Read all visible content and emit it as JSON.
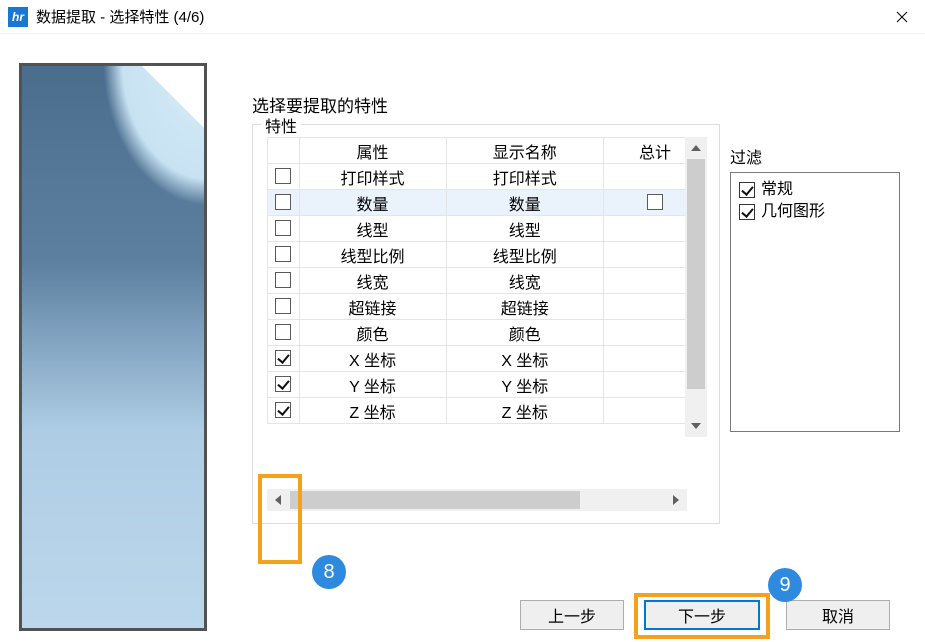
{
  "window": {
    "title": "数据提取 - 选择特性 (4/6)",
    "app_icon_text": "hr"
  },
  "main": {
    "heading": "选择要提取的特性",
    "props_group_label": "特性",
    "table": {
      "headers": {
        "attr": "属性",
        "display": "显示名称",
        "total": "总计"
      },
      "rows": [
        {
          "checked": false,
          "attr": "打印样式",
          "display": "打印样式",
          "total_chk": null,
          "selected": false
        },
        {
          "checked": false,
          "attr": "数量",
          "display": "数量",
          "total_chk": false,
          "selected": true
        },
        {
          "checked": false,
          "attr": "线型",
          "display": "线型",
          "total_chk": null,
          "selected": false
        },
        {
          "checked": false,
          "attr": "线型比例",
          "display": "线型比例",
          "total_chk": null,
          "selected": false
        },
        {
          "checked": false,
          "attr": "线宽",
          "display": "线宽",
          "total_chk": null,
          "selected": false
        },
        {
          "checked": false,
          "attr": "超链接",
          "display": "超链接",
          "total_chk": null,
          "selected": false
        },
        {
          "checked": false,
          "attr": "颜色",
          "display": "颜色",
          "total_chk": null,
          "selected": false
        },
        {
          "checked": true,
          "attr": "X 坐标",
          "display": "X 坐标",
          "total_chk": null,
          "selected": false
        },
        {
          "checked": true,
          "attr": "Y 坐标",
          "display": "Y 坐标",
          "total_chk": null,
          "selected": false
        },
        {
          "checked": true,
          "attr": "Z 坐标",
          "display": "Z 坐标",
          "total_chk": null,
          "selected": false
        }
      ]
    },
    "filter": {
      "label": "过滤",
      "items": [
        {
          "checked": true,
          "label": "常规"
        },
        {
          "checked": true,
          "label": "几何图形"
        }
      ]
    },
    "buttons": {
      "prev": "上一步",
      "next": "下一步",
      "cancel": "取消"
    }
  },
  "annotations": {
    "badge8": "8",
    "badge9": "9"
  }
}
